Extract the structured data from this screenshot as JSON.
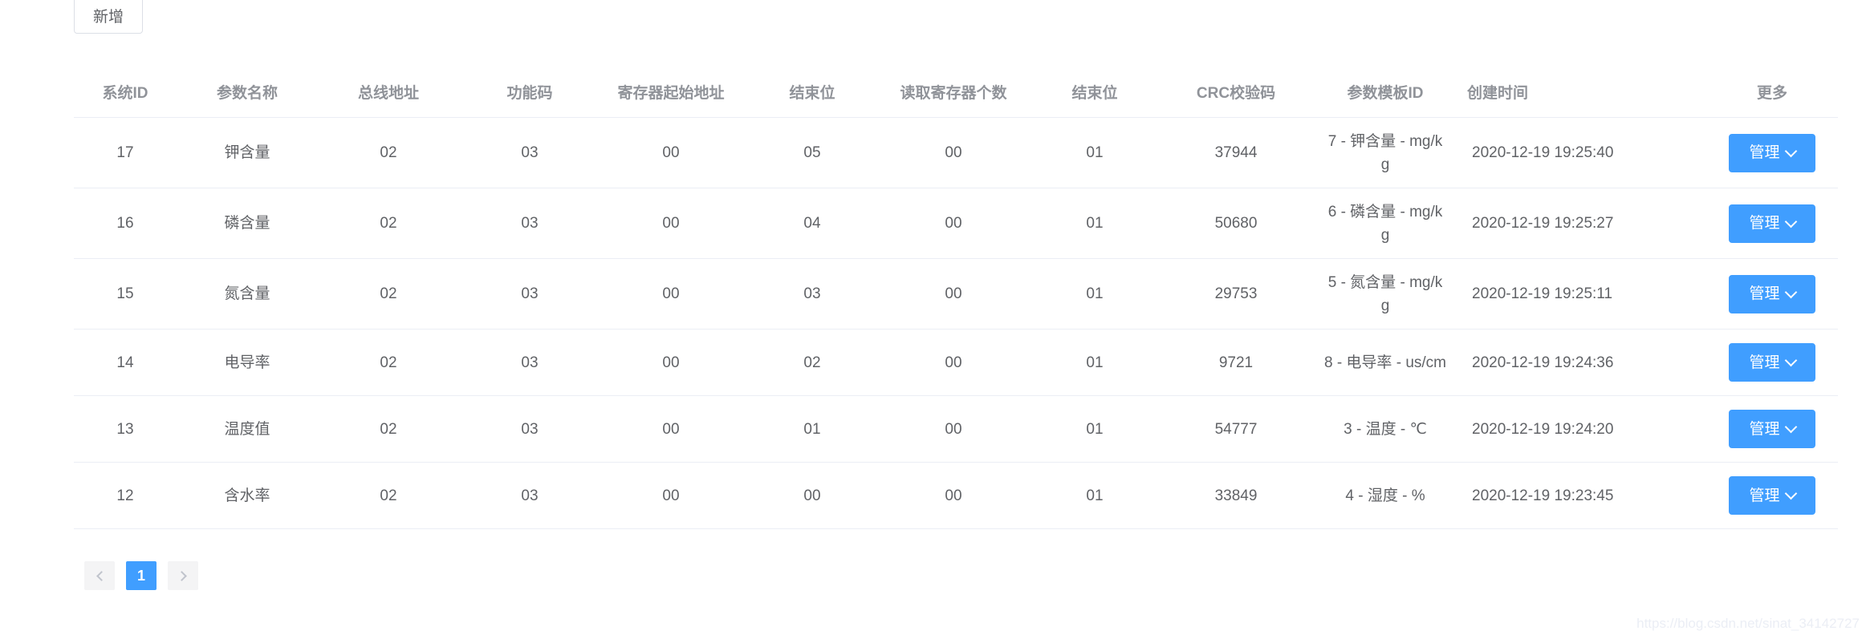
{
  "toolbar": {
    "add_label": "新增"
  },
  "table": {
    "headers": [
      "系统ID",
      "参数名称",
      "总线地址",
      "功能码",
      "寄存器起始地址",
      "结束位",
      "读取寄存器个数",
      "结束位",
      "CRC校验码",
      "参数模板ID",
      "创建时间",
      "更多"
    ],
    "rows": [
      {
        "id": "17",
        "name": "钾含量",
        "bus": "02",
        "func": "03",
        "reg_start": "00",
        "end_bit": "05",
        "reg_count": "00",
        "end_bit2": "01",
        "crc": "37944",
        "tpl_line1": "7 - 钾含量 - mg/k",
        "tpl_line2": "g",
        "created": "2020-12-19 19:25:40",
        "action": "管理"
      },
      {
        "id": "16",
        "name": "磷含量",
        "bus": "02",
        "func": "03",
        "reg_start": "00",
        "end_bit": "04",
        "reg_count": "00",
        "end_bit2": "01",
        "crc": "50680",
        "tpl_line1": "6 - 磷含量 - mg/k",
        "tpl_line2": "g",
        "created": "2020-12-19 19:25:27",
        "action": "管理"
      },
      {
        "id": "15",
        "name": "氮含量",
        "bus": "02",
        "func": "03",
        "reg_start": "00",
        "end_bit": "03",
        "reg_count": "00",
        "end_bit2": "01",
        "crc": "29753",
        "tpl_line1": "5 - 氮含量 - mg/k",
        "tpl_line2": "g",
        "created": "2020-12-19 19:25:11",
        "action": "管理"
      },
      {
        "id": "14",
        "name": "电导率",
        "bus": "02",
        "func": "03",
        "reg_start": "00",
        "end_bit": "02",
        "reg_count": "00",
        "end_bit2": "01",
        "crc": "9721",
        "tpl_line1": "8 - 电导率 - us/cm",
        "tpl_line2": "",
        "created": "2020-12-19 19:24:36",
        "action": "管理"
      },
      {
        "id": "13",
        "name": "温度值",
        "bus": "02",
        "func": "03",
        "reg_start": "00",
        "end_bit": "01",
        "reg_count": "00",
        "end_bit2": "01",
        "crc": "54777",
        "tpl_line1": "3 - 温度 - ℃",
        "tpl_line2": "",
        "created": "2020-12-19 19:24:20",
        "action": "管理"
      },
      {
        "id": "12",
        "name": "含水率",
        "bus": "02",
        "func": "03",
        "reg_start": "00",
        "end_bit": "00",
        "reg_count": "00",
        "end_bit2": "01",
        "crc": "33849",
        "tpl_line1": "4 - 湿度 - %",
        "tpl_line2": "",
        "created": "2020-12-19 19:23:45",
        "action": "管理"
      }
    ]
  },
  "pagination": {
    "current_page": "1"
  },
  "watermark": "https://blog.csdn.net/sinat_34142727",
  "colors": {
    "primary": "#409eff",
    "border": "#ebeef5",
    "header_text": "#909399",
    "body_text": "#606266"
  }
}
